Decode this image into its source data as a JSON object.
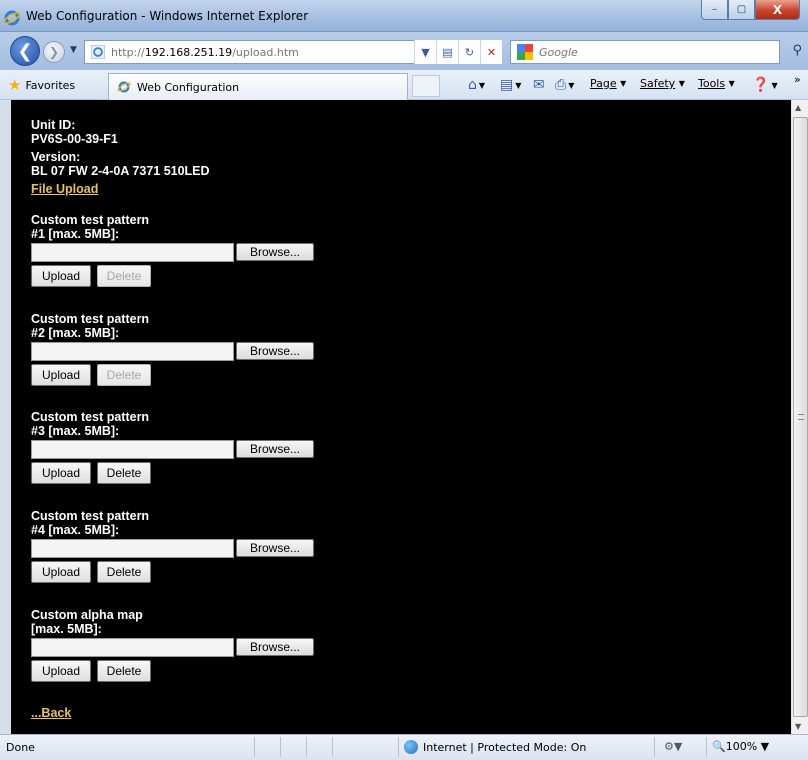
{
  "window": {
    "title": "Web Configuration - Windows Internet Explorer",
    "controls": {
      "minimize": "–",
      "maximize": "▢",
      "close": "X"
    }
  },
  "addressbar": {
    "url_prefix": "http://",
    "url_host": "192.168.251.19",
    "url_path": "/upload.htm",
    "search_placeholder": "Google"
  },
  "favbar": {
    "favorites_label": "Favorites",
    "tab_title": "Web Configuration",
    "commands": {
      "page": "Page",
      "safety": "Safety",
      "tools": "Tools"
    }
  },
  "page": {
    "unit_id_label": "Unit ID:",
    "unit_id_value": "PV6S-00-39-F1",
    "version_label": "Version:",
    "version_value": "BL 07 FW 2-4-0A 7371 510LED",
    "file_upload_link": "File Upload",
    "back_link": "...Back",
    "sections": [
      {
        "line1": "Custom test pattern",
        "line2": "#1 [max. 5MB]:",
        "browse": "Browse...",
        "upload": "Upload",
        "delete": "Delete",
        "delete_enabled": false
      },
      {
        "line1": "Custom test pattern",
        "line2": "#2 [max. 5MB]:",
        "browse": "Browse...",
        "upload": "Upload",
        "delete": "Delete",
        "delete_enabled": false
      },
      {
        "line1": "Custom test pattern",
        "line2": "#3 [max. 5MB]:",
        "browse": "Browse...",
        "upload": "Upload",
        "delete": "Delete",
        "delete_enabled": true
      },
      {
        "line1": "Custom test pattern",
        "line2": "#4 [max. 5MB]:",
        "browse": "Browse...",
        "upload": "Upload",
        "delete": "Delete",
        "delete_enabled": true
      },
      {
        "line1": "Custom alpha map",
        "line2": "[max. 5MB]:",
        "browse": "Browse...",
        "upload": "Upload",
        "delete": "Delete",
        "delete_enabled": true
      }
    ]
  },
  "statusbar": {
    "status": "Done",
    "zone": "Internet | Protected Mode: On",
    "zoom": "100%"
  },
  "colors": {
    "page_background": "#000000",
    "text": "#ffffff",
    "link": "#e8c35a"
  }
}
